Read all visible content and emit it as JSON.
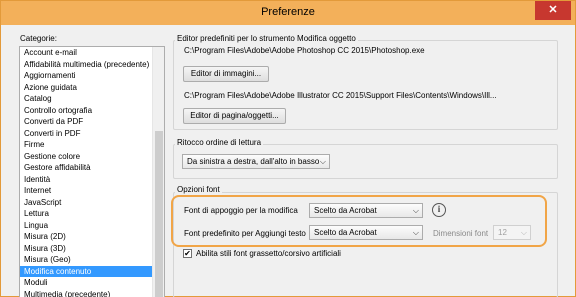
{
  "window": {
    "title": "Preferenze",
    "close_symbol": "✕"
  },
  "categories": {
    "label": "Categorie:",
    "items": [
      "Account e-mail",
      "Affidabilità multimedia (precedente)",
      "Aggiornamenti",
      "Azione guidata",
      "Catalog",
      "Controllo ortografia",
      "Converti da PDF",
      "Converti in PDF",
      "Firme",
      "Gestione colore",
      "Gestore affidabilità",
      "Identità",
      "Internet",
      "JavaScript",
      "Lettura",
      "Lingua",
      "Misura (2D)",
      "Misura (3D)",
      "Misura (Geo)",
      "Modifica contenuto",
      "Moduli",
      "Multimedia (precedente)"
    ],
    "selected": "Modifica contenuto"
  },
  "editor_group": {
    "label": "Editor predefiniti per lo strumento Modifica oggetto",
    "image_path": "C:\\Program Files\\Adobe\\Adobe Photoshop CC 2015\\Photoshop.exe",
    "image_button": "Editor di immagini...",
    "page_path": "C:\\Program Files\\Adobe\\Adobe Illustrator CC 2015\\Support Files\\Contents\\Windows\\Ill...",
    "page_button": "Editor di pagina/oggetti..."
  },
  "reading_group": {
    "label": "Ritocco ordine di lettura",
    "order_value": "Da sinistra a destra, dall'alto in basso"
  },
  "font_group": {
    "label": "Opzioni font",
    "fallback_label": "Font di appoggio per la modifica",
    "fallback_value": "Scelto da Acrobat",
    "default_label": "Font predefinito per Aggiungi testo",
    "default_value": "Scelto da Acrobat",
    "size_label": "Dimensioni font",
    "size_value": "12",
    "info_symbol": "i",
    "bold_italic_label": "Abilita stili font grassetto/corsivo artificiali",
    "bold_italic_checked": "✔"
  },
  "colors": {
    "title_bar": "#f3b05a",
    "selection": "#3399ff",
    "highlight": "#f1a547",
    "close": "#c7372f"
  }
}
